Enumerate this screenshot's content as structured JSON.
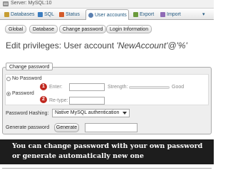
{
  "breadcrumb": {
    "server_label": "Server: MySQL:10",
    "icon": "server-icon"
  },
  "tabs": [
    {
      "label": "Databases",
      "icon": "database-icon"
    },
    {
      "label": "SQL",
      "icon": "sql-icon"
    },
    {
      "label": "Status",
      "icon": "status-icon"
    },
    {
      "label": "User accounts",
      "icon": "users-icon",
      "active": true
    },
    {
      "label": "Export",
      "icon": "export-icon"
    },
    {
      "label": "Import",
      "icon": "import-icon"
    },
    {
      "label": "▾",
      "icon": "more-icon"
    }
  ],
  "subtabs": [
    "Global",
    "Database",
    "Change password",
    "Login Information"
  ],
  "page": {
    "title_prefix": "Edit privileges: User account ",
    "account": "'NewAccount'@'%'"
  },
  "change_password": {
    "legend": "Change password",
    "no_password_label": "No Password",
    "password_label": "Password",
    "selected": "password",
    "enter_label": "Enter:",
    "retype_label": "Re-type:",
    "strength_label": "Strength:",
    "strength_value": "Good",
    "enter_value": "",
    "retype_value": "",
    "badge_1": "1",
    "badge_2": "2",
    "hashing_label": "Password Hashing:",
    "hashing_value": "Native MySQL authentication",
    "generate_label": "Generate password",
    "generate_button": "Generate",
    "generated_value": ""
  },
  "caption": {
    "line1": "You can change password with your own password",
    "line2": "or generate automatically new one"
  },
  "colors": {
    "accent": "#235a81",
    "badge": "#c0281f",
    "caption_bg": "#1d1d1d"
  }
}
